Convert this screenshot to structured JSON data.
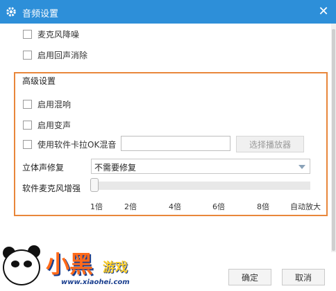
{
  "window": {
    "title": "音频设置"
  },
  "options": [
    {
      "label": "麦克风降噪",
      "checked": false
    },
    {
      "label": "启用回声消除",
      "checked": false
    }
  ],
  "advanced": {
    "title": "高级设置",
    "reverb_label": "启用混响",
    "voice_change_label": "启用变声",
    "ktv_label": "使用软件卡拉OK混音",
    "ktv_value": "",
    "player_button": "选择播放器",
    "stereo_label": "立体声修复",
    "stereo_value": "不需要修复",
    "mic_enhance_label": "软件麦克风增强",
    "mic_enhance_level": 0,
    "ticks": [
      "1倍",
      "2倍",
      "4倍",
      "6倍",
      "8倍",
      "自动放大"
    ]
  },
  "footer": {
    "ok": "确定",
    "cancel": "取消"
  },
  "watermark": {
    "brand": "小黑",
    "brand2": "游戏",
    "url": "www.xiaohei.com"
  },
  "colors": {
    "titlebar": "#2d8fd9",
    "highlight_border": "#e8863a"
  }
}
